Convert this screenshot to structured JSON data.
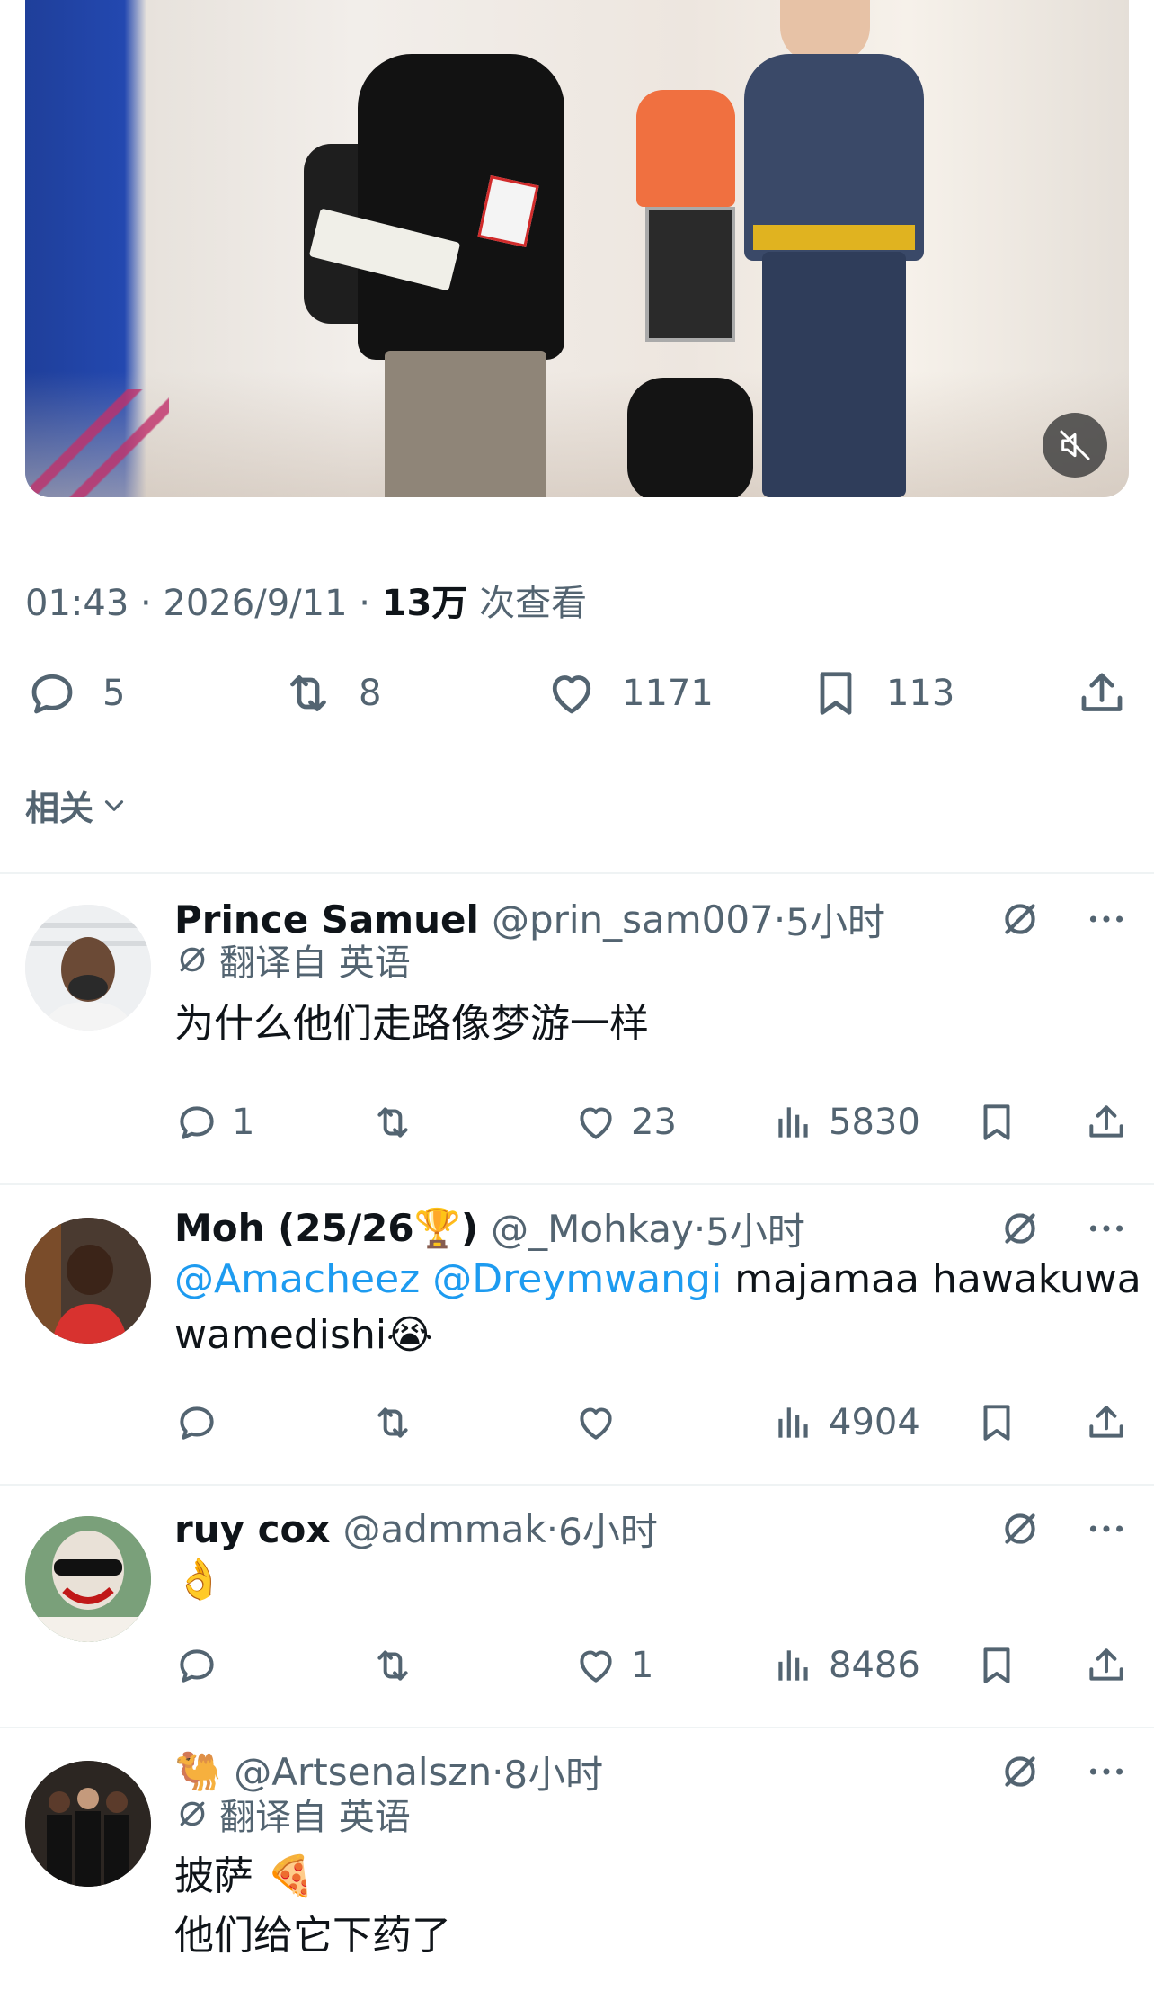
{
  "video": {
    "muted_icon": "muted-speaker-icon"
  },
  "tweet": {
    "time": "01:43",
    "sep1": " · ",
    "date": "2026/9/11",
    "sep2": " · ",
    "views_num": "13万",
    "views_label": " 次查看"
  },
  "tweet_actions": {
    "replies": "5",
    "retweets": "8",
    "likes": "1171",
    "bookmarks": "113"
  },
  "related_label": "相关",
  "replies": [
    {
      "name": "Prince Samuel",
      "handle": "@prin_sam007",
      "sep": " · ",
      "time": "5小时",
      "translated": "翻译自 英语",
      "text": "为什么他们走路像梦游一样",
      "replies": "1",
      "retweets": "",
      "likes": "23",
      "views": "5830"
    },
    {
      "name": "Moh (25/26",
      "name_emoji": "🏆",
      "name_tail": ")",
      "handle": "@_Mohkay",
      "sep": " · ",
      "time": "5小时",
      "mention1": "@Amacheez",
      "mention2": "@Dreymwangi",
      "text_tail": " majamaa hawakuwa",
      "text_line2": "wamedishi",
      "text_emoji": "😭",
      "replies": "",
      "retweets": "",
      "likes": "",
      "views": "4904"
    },
    {
      "name": "ruy cox",
      "handle": "@admmak",
      "sep": " · ",
      "time": "6小时",
      "text_emoji": "👌",
      "replies": "",
      "retweets": "",
      "likes": "1",
      "views": "8486"
    },
    {
      "name_emoji": "🐫",
      "handle": "@Artsenalszn",
      "sep": " · ",
      "time": "8小时",
      "translated": "翻译自 英语",
      "text_line1": "披萨",
      "text_emoji": "🍕",
      "text_line2": "他们给它下药了"
    }
  ]
}
